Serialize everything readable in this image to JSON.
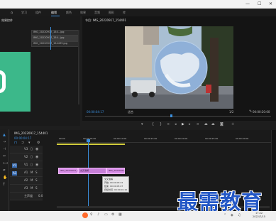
{
  "window": {
    "minimize": "—",
    "maximize": "☐",
    "close": "✕"
  },
  "menu": [
    "学习",
    "组件",
    "编辑",
    "颜色",
    "效果",
    "音频",
    "图形",
    "库"
  ],
  "project": {
    "tab": "效果控件",
    "clips": [
      "IMG_20220917_154...jpg",
      "IMG_20220917_154...jpg",
      "IMG_20220917_154439.jpg"
    ]
  },
  "program": {
    "tab": "节目: IMG_20220917_154401",
    "timecode": "00:00:04:17",
    "fit": "适合",
    "ratio": "1/2",
    "duration": "00:00:20:00"
  },
  "timeline": {
    "tab": "IMG_20220917_154401",
    "timecode": "00:00:04:17",
    "ruler": [
      "00:00",
      "00:00:05:00",
      "00:00:10:00",
      "00:00:15:00",
      "00:00:20:00",
      "00:00:25:00",
      "00:00:30:00"
    ],
    "tracks": [
      {
        "label": "V3",
        "state": ""
      },
      {
        "label": "V2",
        "state": ""
      },
      {
        "label": "V1",
        "state": "V1"
      },
      {
        "label": "A1",
        "state": "A1"
      },
      {
        "label": "A2",
        "state": ""
      },
      {
        "label": "A3",
        "state": ""
      },
      {
        "label": "主声道",
        "state": "0.0"
      }
    ],
    "clips": [
      "IMG_20220917_154...",
      "交叉溶解",
      "IMG_20220917_154..."
    ]
  },
  "tooltip": {
    "title": "交叉溶解",
    "start": "开始: 00:00:03:22",
    "end": "结束: 00:00:05:07",
    "duration": "持续时间: 00:00:01:10"
  },
  "watermark": "最需教育",
  "taskbar": {
    "time": "17:22",
    "date": "2022/7/15"
  }
}
